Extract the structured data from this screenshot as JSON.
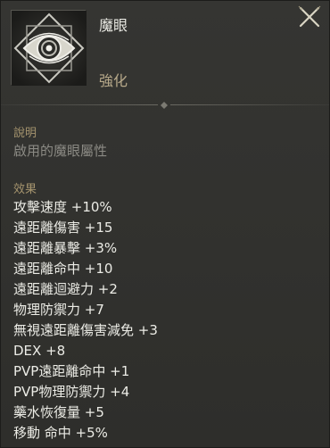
{
  "header": {
    "skill_name": "魔眼",
    "skill_type": "強化",
    "icon": "eye-icon",
    "close_icon": "close-icon"
  },
  "description": {
    "label": "說明",
    "text": "啟用的魔眼屬性"
  },
  "effects": {
    "label": "效果",
    "items": [
      "攻擊速度 +10%",
      "遠距離傷害 +15",
      "遠距離暴擊 +3%",
      "遠距離命中 +10",
      "遠距離迴避力 +2",
      "物理防禦力 +7",
      "無視遠距離傷害減免 +3",
      "DEX +8",
      "PVP遠距離命中 +1",
      "PVP物理防禦力 +4",
      "藥水恢復量 +5",
      "移動 命中 +5%"
    ]
  },
  "colors": {
    "background": "#2e2e2b",
    "section_label": "#a5946e",
    "skill_type": "#b7a98a",
    "body_text": "#ecece6",
    "muted_text": "#8b8a84"
  }
}
